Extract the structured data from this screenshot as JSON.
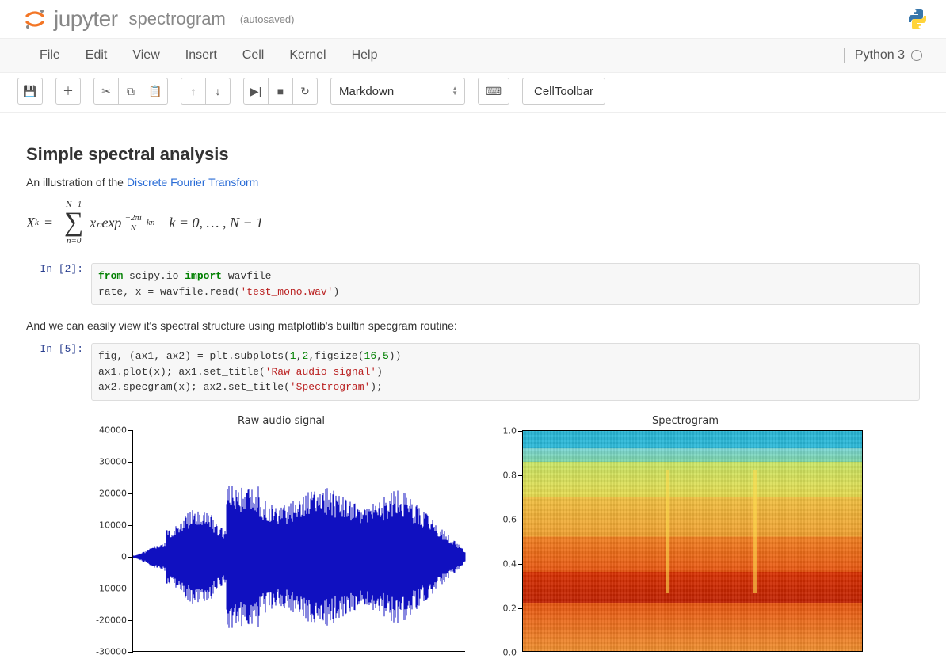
{
  "header": {
    "logo_word": "jupyter",
    "notebook_name": "spectrogram",
    "autosaved": "(autosaved)"
  },
  "menubar": {
    "items": [
      "File",
      "Edit",
      "View",
      "Insert",
      "Cell",
      "Kernel",
      "Help"
    ],
    "kernel_name": "Python 3"
  },
  "toolbar": {
    "cell_type": "Markdown",
    "celltoolbar_label": "CellToolbar"
  },
  "notebook": {
    "heading": "Simple spectral analysis",
    "intro_prefix": "An illustration of the ",
    "intro_link": "Discrete Fourier Transform",
    "formula": {
      "lhs": "X",
      "lhs_sub": "k",
      "sum_top": "N−1",
      "sum_bot": "n=0",
      "body": "xₙexp",
      "frac_num": "−2πi",
      "frac_den": "N",
      "exp_tail": "kn",
      "range": "k = 0, … , N − 1"
    },
    "cell1": {
      "prompt": "In [2]:",
      "tokens": [
        {
          "t": "from",
          "c": "kw-green"
        },
        {
          "t": " scipy.io "
        },
        {
          "t": "import",
          "c": "kw-green"
        },
        {
          "t": " wavfile\n"
        },
        {
          "t": "rate, x "
        },
        {
          "t": "=",
          "c": ""
        },
        {
          "t": " wavfile"
        },
        {
          "t": ".",
          "c": ""
        },
        {
          "t": "read("
        },
        {
          "t": "'test_mono.wav'",
          "c": "str-red"
        },
        {
          "t": ")"
        }
      ]
    },
    "md2": "And we can easily view it's spectral structure using matplotlib's builtin specgram routine:",
    "cell2": {
      "prompt": "In [5]:",
      "tokens": [
        {
          "t": "fig, (ax1, ax2) "
        },
        {
          "t": "="
        },
        {
          "t": " plt"
        },
        {
          "t": "."
        },
        {
          "t": "subplots("
        },
        {
          "t": "1",
          "c": "num-green"
        },
        {
          "t": ","
        },
        {
          "t": "2",
          "c": "num-green"
        },
        {
          "t": ",figsize("
        },
        {
          "t": "16",
          "c": "num-green"
        },
        {
          "t": ","
        },
        {
          "t": "5",
          "c": "num-green"
        },
        {
          "t": "))\n"
        },
        {
          "t": "ax1"
        },
        {
          "t": "."
        },
        {
          "t": "plot(x); ax1"
        },
        {
          "t": "."
        },
        {
          "t": "set_title("
        },
        {
          "t": "'Raw audio signal'",
          "c": "str-red"
        },
        {
          "t": ")\n"
        },
        {
          "t": "ax2"
        },
        {
          "t": "."
        },
        {
          "t": "specgram(x); ax2"
        },
        {
          "t": "."
        },
        {
          "t": "set_title("
        },
        {
          "t": "'Spectrogram'",
          "c": "str-red"
        },
        {
          "t": ");"
        }
      ]
    }
  },
  "chart_data": [
    {
      "type": "line",
      "title": "Raw audio signal",
      "ylim": [
        -30000,
        40000
      ],
      "yticks": [
        -30000,
        -20000,
        -10000,
        0,
        10000,
        20000,
        30000,
        40000
      ],
      "xlabel": "",
      "ylabel": "",
      "note": "dense oscillatory waveform; values estimated from axis",
      "series": [
        {
          "name": "signal",
          "color": "#1010c0"
        }
      ]
    },
    {
      "type": "heatmap",
      "title": "Spectrogram",
      "ylim": [
        0.0,
        1.0
      ],
      "yticks": [
        0.0,
        0.2,
        0.4,
        0.6,
        0.8,
        1.0
      ],
      "xlabel": "",
      "ylabel": "",
      "colormap": "jet-like (blue=low, red=high)"
    }
  ]
}
